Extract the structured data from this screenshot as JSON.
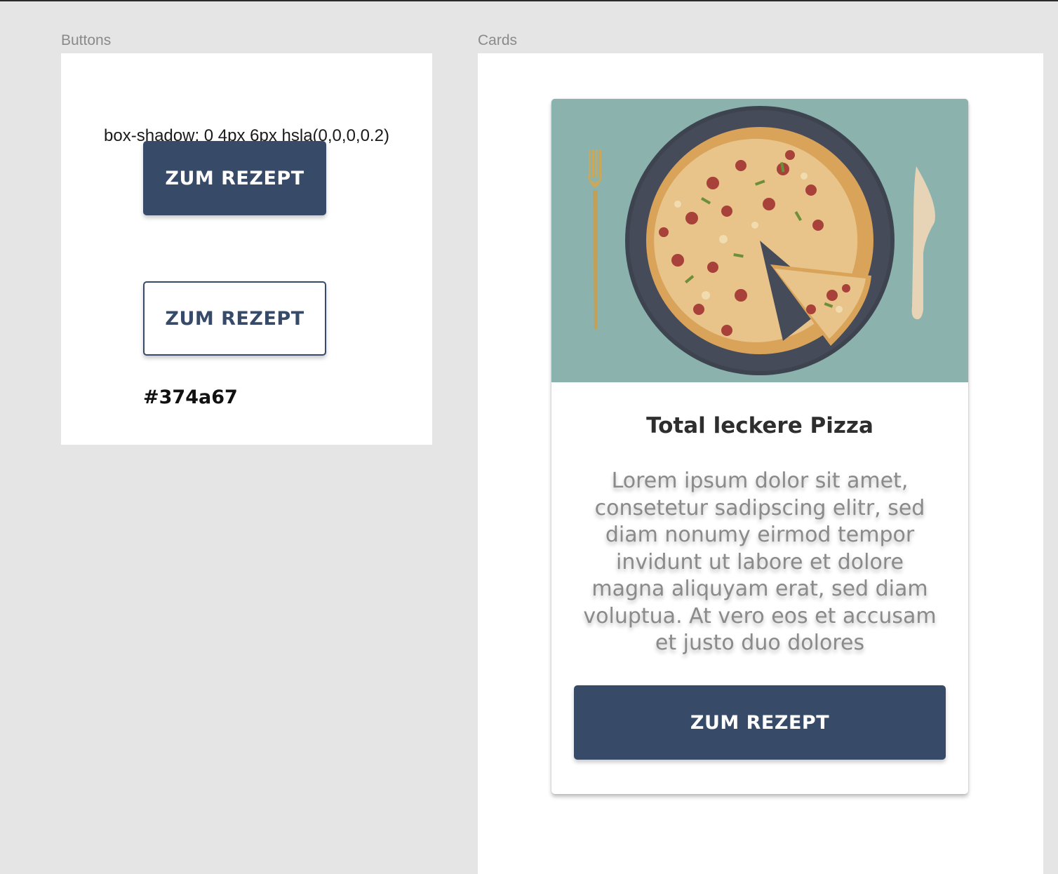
{
  "buttons_frame": {
    "label": "Buttons",
    "shadow_note": "box-shadow: 0 4px 6px hsla(0,0,0,0.2)",
    "primary_button_label": "ZUM REZEPT",
    "outline_button_label": "ZUM REZEPT",
    "hex_color_label": "#374a67"
  },
  "cards_frame": {
    "label": "Cards",
    "card": {
      "image_icon": "pizza-image",
      "title": "Total leckere Pizza",
      "text": "Lorem ipsum dolor sit amet, consetetur sadipscing elitr, sed diam nonumy eirmod tempor invidunt ut labore et dolore magna aliquyam erat, sed diam voluptua. At vero eos et accusam et justo duo dolores",
      "button_label": "ZUM REZEPT"
    }
  },
  "colors": {
    "primary": "#374a67",
    "canvas_background": "#e5e5e5",
    "image_background": "#8bb2ad"
  }
}
